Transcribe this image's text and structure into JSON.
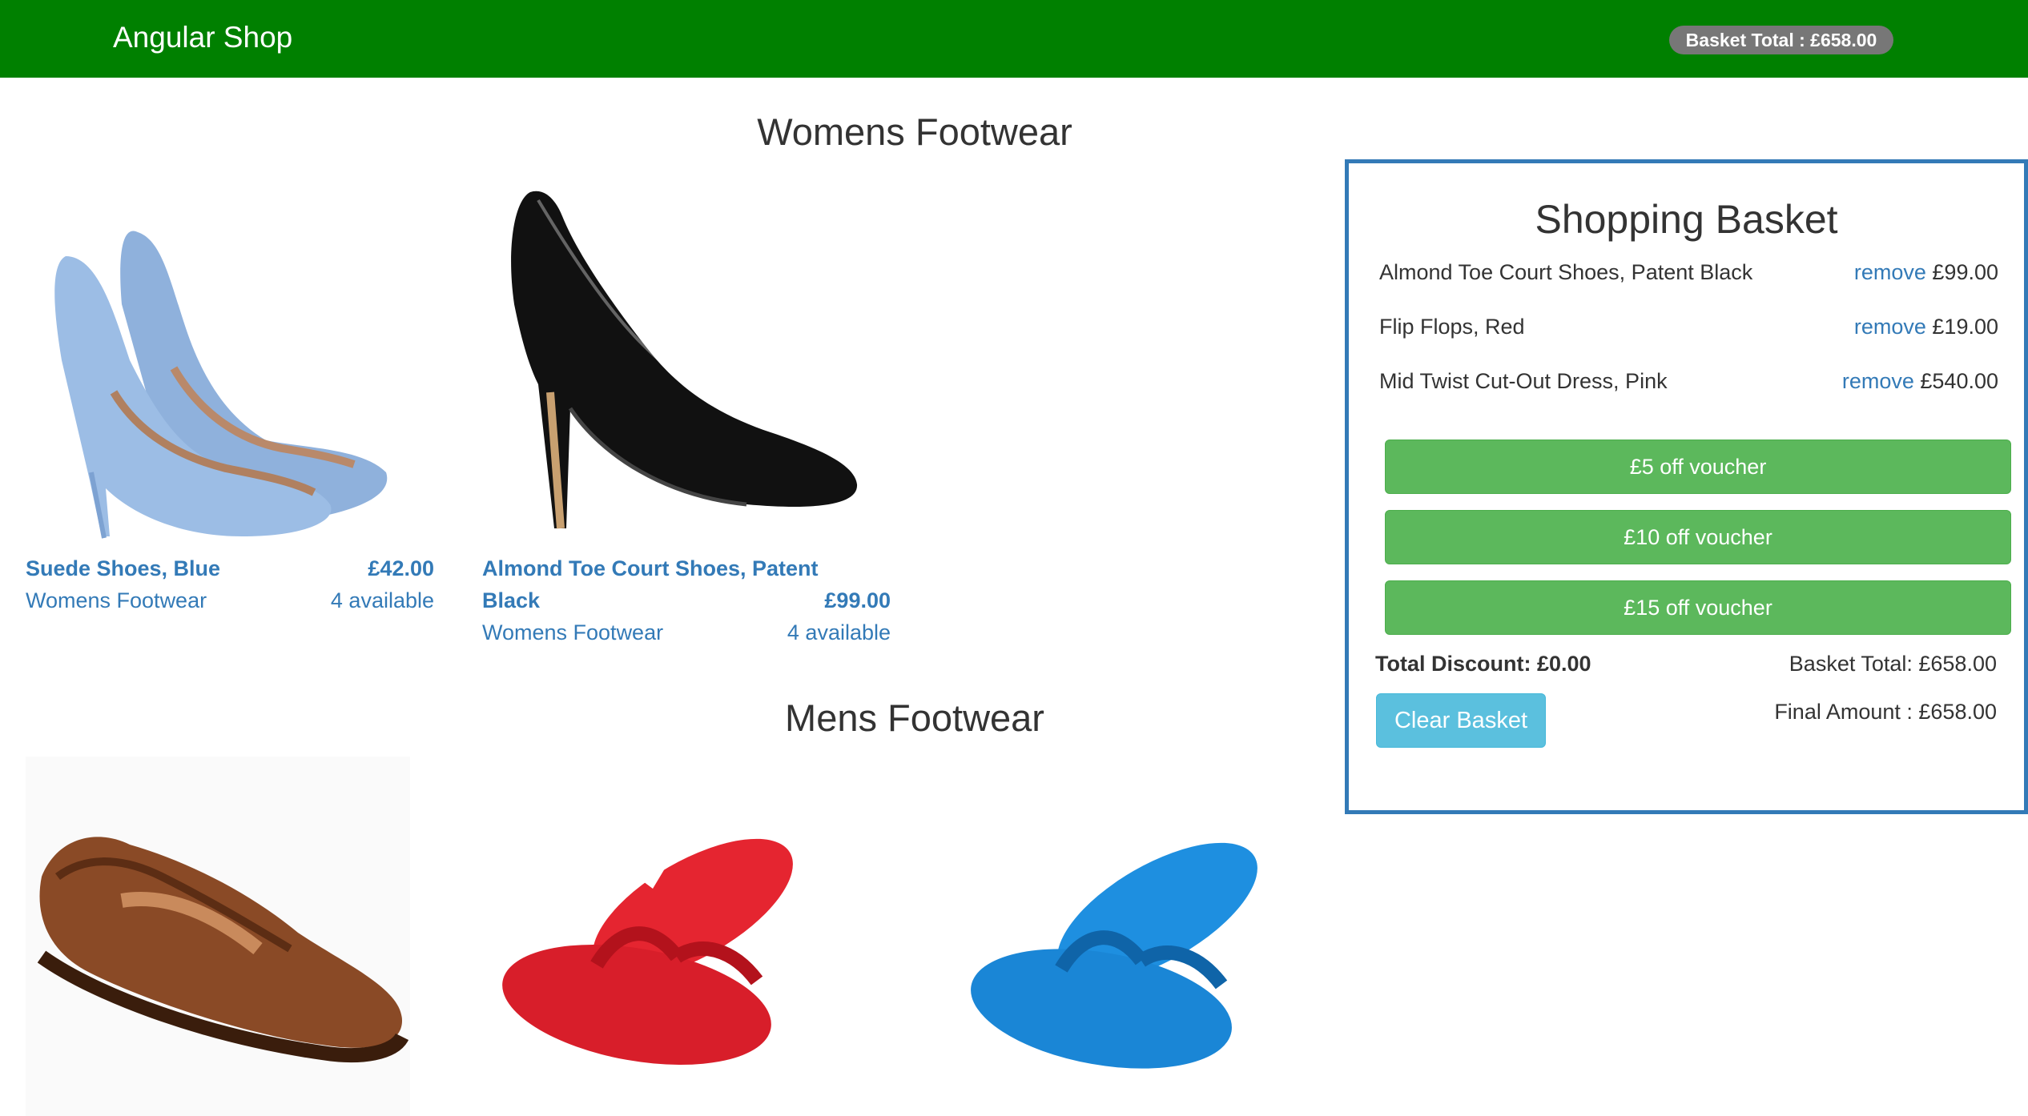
{
  "navbar": {
    "brand": "Angular Shop",
    "basket_badge": "Basket Total : £658.00"
  },
  "sections": [
    {
      "title": "Womens Footwear",
      "products": [
        {
          "name": "Suede Shoes, Blue",
          "price": "£42.00",
          "category": "Womens Footwear",
          "availability": "4 available",
          "image": "blue-suede-heel"
        },
        {
          "name_line1": "Almond Toe Court Shoes, Patent",
          "name_line2": "Black",
          "price": "£99.00",
          "category": "Womens Footwear",
          "availability": "4 available",
          "image": "black-patent-heel"
        }
      ]
    },
    {
      "title": "Mens Footwear",
      "products": [
        {
          "image": "brown-leather-loafer"
        },
        {
          "image": "red-flip-flops"
        },
        {
          "image": "blue-flip-flops"
        }
      ]
    }
  ],
  "basket": {
    "title": "Shopping Basket",
    "items": [
      {
        "name": "Almond Toe Court Shoes, Patent Black",
        "remove_label": "remove",
        "price": "£99.00"
      },
      {
        "name": "Flip Flops, Red",
        "remove_label": "remove",
        "price": "£19.00"
      },
      {
        "name": "Mid Twist Cut-Out Dress, Pink",
        "remove_label": "remove",
        "price": "£540.00"
      }
    ],
    "vouchers": [
      "£5 off voucher",
      "£10 off voucher",
      "£15 off voucher"
    ],
    "total_discount": "Total Discount: £0.00",
    "basket_total": "Basket Total: £658.00",
    "final_amount": "Final Amount : £658.00",
    "clear_label": "Clear Basket"
  },
  "colors": {
    "navbar": "#008000",
    "link": "#337ab7",
    "success": "#5cb85c",
    "info": "#5bc0de",
    "badge": "#777777"
  }
}
